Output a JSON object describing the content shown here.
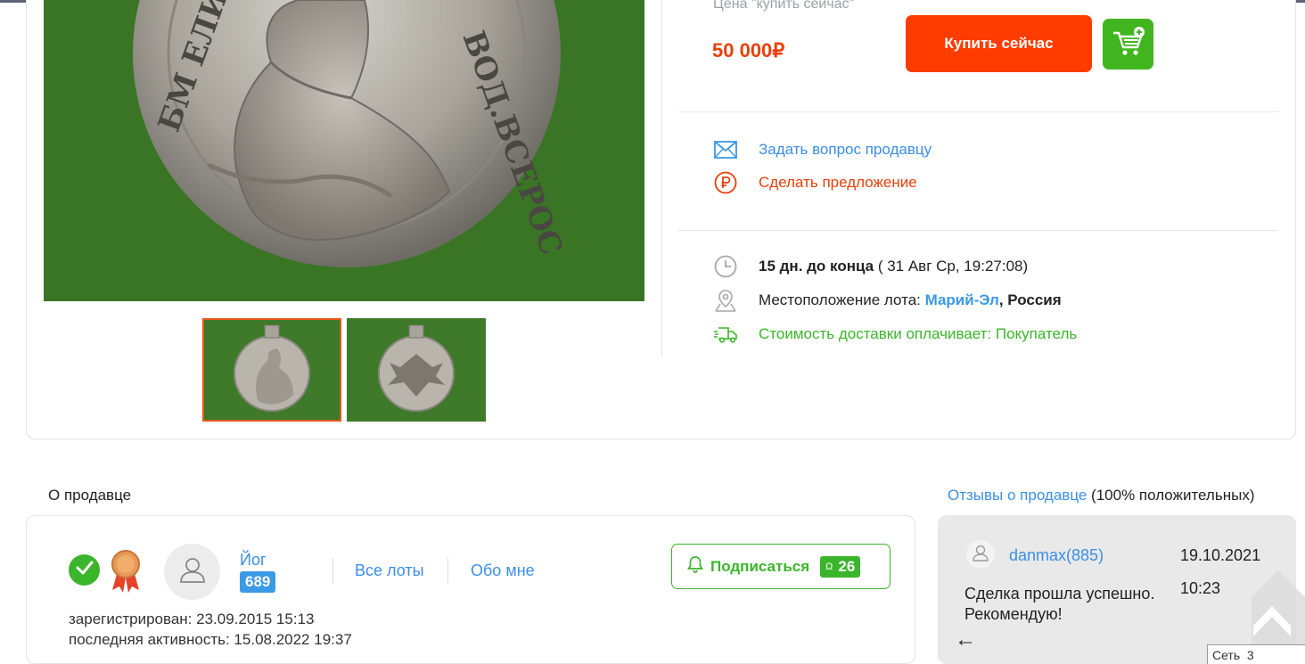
{
  "price_block": {
    "caption": "Цена \"купить сейчас\"",
    "price": "50 000₽",
    "buy_label": "Купить сейчас"
  },
  "actions": {
    "ask_seller": "Задать вопрос продавцу",
    "make_offer": "Сделать предложение"
  },
  "lot_info": {
    "time_left": "15 дн. до конца",
    "end_date": " ( 31 Авг Ср, 19:27:08)",
    "location_label": "Местоположение лота: ",
    "location_region": "Марий-Эл",
    "location_country": ", Россия",
    "delivery_label": "Стоимость доставки оплачивает: ",
    "delivery_payer": "Покупатель"
  },
  "seller": {
    "section_title": "О продавце",
    "name": "Йог",
    "rating": "689",
    "all_lots": "Все лоты",
    "about": "Обо мне",
    "subscribe": "Подписаться",
    "subscribers": "26",
    "registered": "зарегистрирован: 23.09.2015 15:13",
    "last_activity": "последняя активность: 15.08.2022 19:37"
  },
  "reviews": {
    "link": "Отзывы о продавце",
    "summary": " (100% положительных)",
    "items": [
      {
        "user": "danmax(885)",
        "date": "19.10.2021",
        "time": "10:23",
        "text": "Сделка прошла успешно. Рекомендую!"
      }
    ],
    "back_arrow": "←"
  },
  "status": {
    "network": "Сеть  3"
  },
  "colors": {
    "accent_orange": "#ff3c00",
    "price_red": "#e8400c",
    "link_blue": "#3b8ee6",
    "success_green": "#3bb52b"
  },
  "icons": [
    "mail-icon",
    "ruble-icon",
    "clock-icon",
    "location-icon",
    "delivery-truck-icon",
    "cart-add-icon",
    "check-icon",
    "medal-icon",
    "user-icon",
    "bell-icon",
    "scroll-top-icon"
  ]
}
